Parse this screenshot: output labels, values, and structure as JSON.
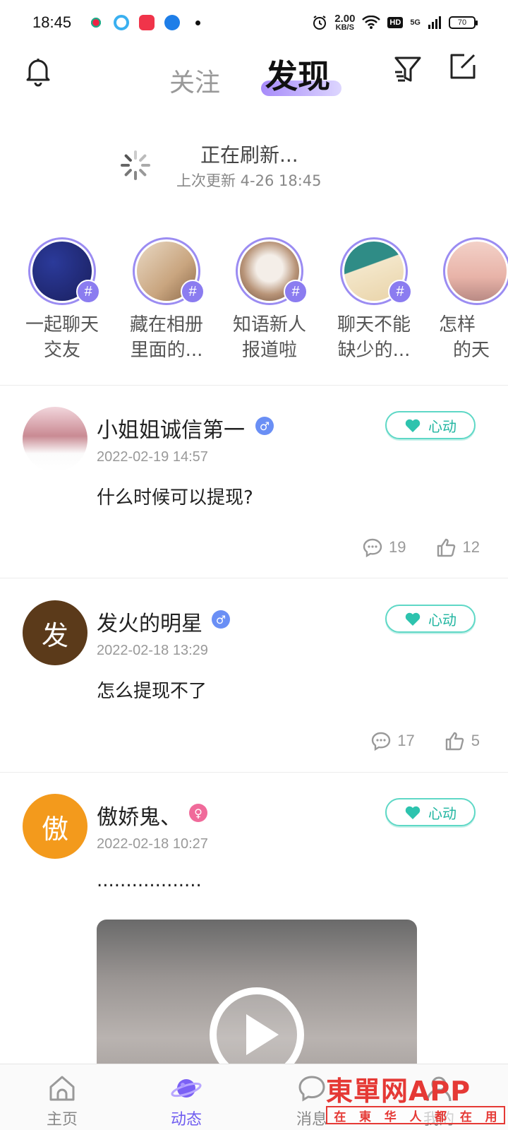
{
  "status_bar": {
    "time": "18:45",
    "net_speed_value": "2.00",
    "net_speed_unit": "KB/S",
    "hd": "HD",
    "signal": "5G",
    "battery": "70"
  },
  "header": {
    "tab_follow": "关注",
    "tab_discover": "发现"
  },
  "refresh": {
    "title": "正在刷新...",
    "subtitle": "上次更新 4-26 18:45"
  },
  "topics": [
    {
      "line1": "一起聊天",
      "line2": "交友"
    },
    {
      "line1": "藏在相册",
      "line2": "里面的..."
    },
    {
      "line1": "知语新人",
      "line2": "报道啦"
    },
    {
      "line1": "聊天不能",
      "line2": "缺少的..."
    },
    {
      "line1": "怎样",
      "line2": "的天"
    }
  ],
  "topic_badge": "#",
  "heart_label": "心动",
  "posts": [
    {
      "name": "小姐姐诚信第一",
      "gender": "♂",
      "time": "2022-02-19 14:57",
      "text": "什么时候可以提现?",
      "comments": "19",
      "likes": "12",
      "avatar_char": ""
    },
    {
      "name": "发火的明星",
      "gender": "♂",
      "time": "2022-02-18 13:29",
      "text": "怎么提现不了",
      "comments": "17",
      "likes": "5",
      "avatar_char": "发"
    },
    {
      "name": "傲娇鬼、",
      "gender": "♀",
      "time": "2022-02-18 10:27",
      "text": "..................",
      "avatar_char": "傲"
    }
  ],
  "nav": {
    "home": "主页",
    "feed": "动态",
    "messages": "消息",
    "mine": "我的"
  },
  "watermark": {
    "main": "東單网APP",
    "sub": [
      "在",
      "東",
      "华",
      "人",
      "都",
      "在",
      "用"
    ]
  },
  "colors": {
    "accent": "#6f5cf0",
    "heart": "#20b5a0",
    "male": "#6a8ff5",
    "female": "#f06a9a"
  }
}
